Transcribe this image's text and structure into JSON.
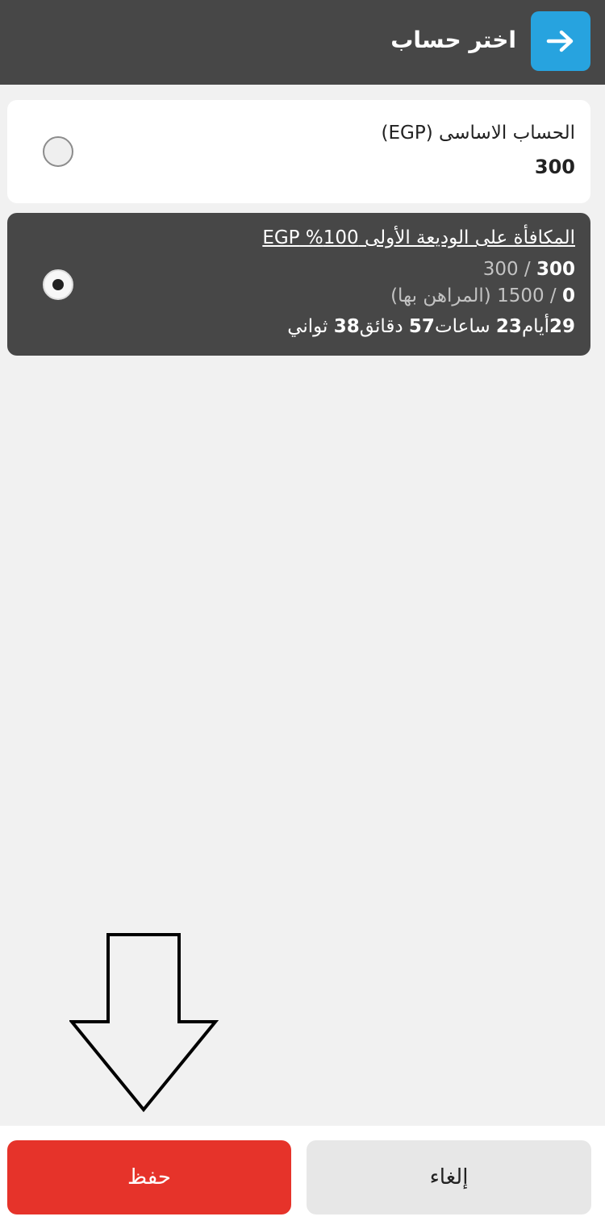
{
  "header": {
    "title": "اختر حساب",
    "back_icon": "arrow-right-icon",
    "accent_color": "#27a3df"
  },
  "accounts": [
    {
      "name": "الحساب الاساسى (EGP)",
      "amount": "300",
      "selected": false
    },
    {
      "title": "المكافأة على الوديعة الأولى 100% EGP",
      "balance_current": "300",
      "balance_sep": "/",
      "balance_total": "300",
      "wager_current": "0",
      "wager_sep": "/",
      "wager_total": "1500 (المراهن بها)",
      "time_days": "29",
      "time_days_label": "أيام",
      "time_hours": "23",
      "time_hours_label": "ساعات",
      "time_minutes": "57",
      "time_minutes_label": "دقائق",
      "time_seconds": "38",
      "time_seconds_label": "ثواني",
      "selected": true
    }
  ],
  "footer": {
    "save_label": "حفظ",
    "cancel_label": "إلغاء",
    "save_color": "#e6332a"
  },
  "annotation": {
    "icon": "down-arrow-outline-icon"
  }
}
